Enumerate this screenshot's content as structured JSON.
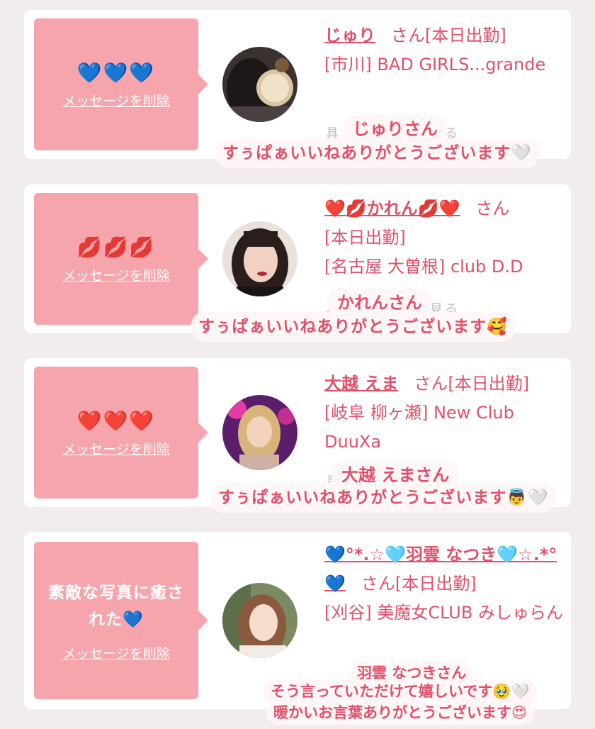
{
  "delete_label": "メッセージを削除",
  "san": "さん",
  "working": "[本日出勤]",
  "cards": [
    {
      "message": "💙💙💙",
      "name": "じゅり",
      "store": "[市川] BAD GIRLS...grande",
      "overlay_name": "じゅりさん",
      "overlay_lines": [
        "すぅぱぁいいねありがとうございます🤍"
      ]
    },
    {
      "message": "💋💋💋",
      "name": "❤️💋かれん💋❤️",
      "store": "[名古屋 大曽根] club D.D",
      "overlay_name": "かれんさん",
      "overlay_lines": [
        "すぅぱぁいいねありがとうございます🥰"
      ]
    },
    {
      "message": "❤️❤️❤️",
      "name": "大越 えま",
      "store": "[岐阜 柳ヶ瀬] New Club DuuXa",
      "overlay_name": "大越 えまさん",
      "overlay_lines": [
        "すぅぱぁいいねありがとうございます👼🤍"
      ]
    },
    {
      "message": "素敵な写真に癒された💙",
      "name": "💙°*.☆🩵羽雲 なつき🩵☆.*°💙",
      "store": "[刈谷] 美魔女CLUB みしゅらん",
      "overlay_name": "羽雲 なつきさん",
      "overlay_lines": [
        "そう言っていただけて嬉しいです🥹🤍",
        "暖かいお言葉ありがとうございます😍"
      ]
    }
  ],
  "colors": {
    "accent": "#e0506a",
    "bubble": "#f7a5ad",
    "background": "#f2ecec"
  }
}
